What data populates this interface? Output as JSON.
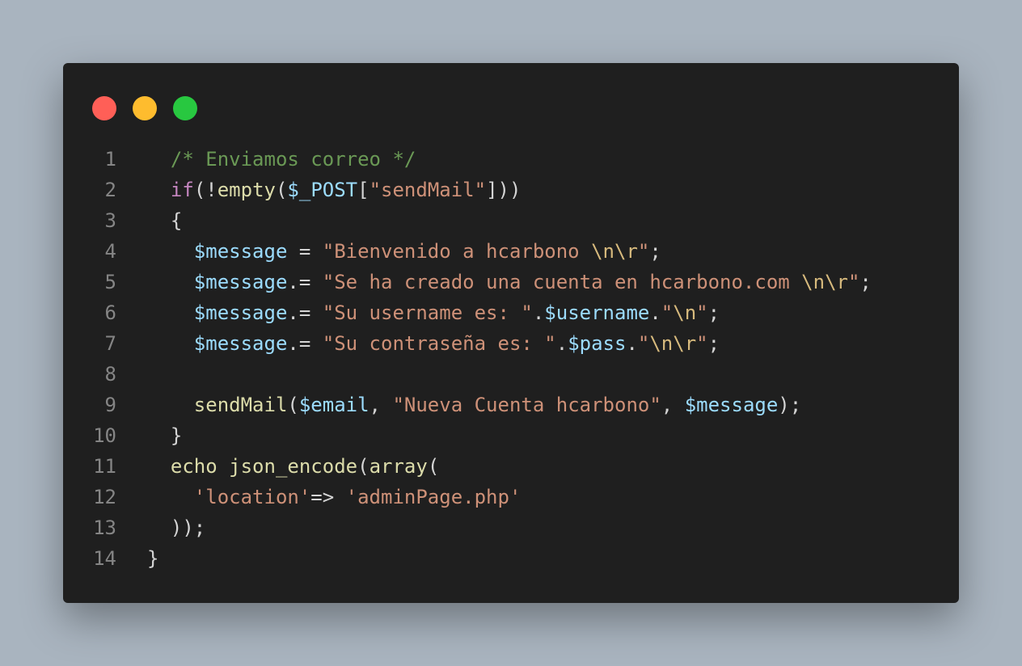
{
  "window": {
    "controls": {
      "close_color": "#ff5f57",
      "minimize_color": "#febc2e",
      "maximize_color": "#28c840"
    }
  },
  "code": {
    "language": "php",
    "line_numbers": [
      "1",
      "2",
      "3",
      "4",
      "5",
      "6",
      "7",
      "8",
      "9",
      "10",
      "11",
      "12",
      "13",
      "14"
    ],
    "lines": [
      [
        {
          "t": "  "
        },
        {
          "t": "/* Enviamos correo */",
          "c": "comment"
        }
      ],
      [
        {
          "t": "  "
        },
        {
          "t": "if",
          "c": "keyword"
        },
        {
          "t": "(!"
        },
        {
          "t": "empty",
          "c": "func"
        },
        {
          "t": "("
        },
        {
          "t": "$_POST",
          "c": "var"
        },
        {
          "t": "["
        },
        {
          "t": "\"sendMail\"",
          "c": "str"
        },
        {
          "t": "]))"
        }
      ],
      [
        {
          "t": "  {"
        }
      ],
      [
        {
          "t": "    "
        },
        {
          "t": "$message",
          "c": "var"
        },
        {
          "t": " = "
        },
        {
          "t": "\"Bienvenido a hcarbono ",
          "c": "str"
        },
        {
          "t": "\\n\\r",
          "c": "esc"
        },
        {
          "t": "\"",
          "c": "str"
        },
        {
          "t": ";"
        }
      ],
      [
        {
          "t": "    "
        },
        {
          "t": "$message",
          "c": "var"
        },
        {
          "t": ".= "
        },
        {
          "t": "\"Se ha creado una cuenta en hcarbono.com ",
          "c": "str"
        },
        {
          "t": "\\n\\r",
          "c": "esc"
        },
        {
          "t": "\"",
          "c": "str"
        },
        {
          "t": ";"
        }
      ],
      [
        {
          "t": "    "
        },
        {
          "t": "$message",
          "c": "var"
        },
        {
          "t": ".= "
        },
        {
          "t": "\"Su username es: \"",
          "c": "str"
        },
        {
          "t": "."
        },
        {
          "t": "$username",
          "c": "var"
        },
        {
          "t": "."
        },
        {
          "t": "\"",
          "c": "str"
        },
        {
          "t": "\\n",
          "c": "esc"
        },
        {
          "t": "\"",
          "c": "str"
        },
        {
          "t": ";"
        }
      ],
      [
        {
          "t": "    "
        },
        {
          "t": "$message",
          "c": "var"
        },
        {
          "t": ".= "
        },
        {
          "t": "\"Su contraseña es: \"",
          "c": "str"
        },
        {
          "t": "."
        },
        {
          "t": "$pass",
          "c": "var"
        },
        {
          "t": "."
        },
        {
          "t": "\"",
          "c": "str"
        },
        {
          "t": "\\n\\r",
          "c": "esc"
        },
        {
          "t": "\"",
          "c": "str"
        },
        {
          "t": ";"
        }
      ],
      [],
      [
        {
          "t": "    "
        },
        {
          "t": "sendMail",
          "c": "func"
        },
        {
          "t": "("
        },
        {
          "t": "$email",
          "c": "var"
        },
        {
          "t": ", "
        },
        {
          "t": "\"Nueva Cuenta hcarbono\"",
          "c": "str"
        },
        {
          "t": ", "
        },
        {
          "t": "$message",
          "c": "var"
        },
        {
          "t": ");"
        }
      ],
      [
        {
          "t": "  }"
        }
      ],
      [
        {
          "t": "  "
        },
        {
          "t": "echo",
          "c": "func"
        },
        {
          "t": " "
        },
        {
          "t": "json_encode",
          "c": "func"
        },
        {
          "t": "("
        },
        {
          "t": "array",
          "c": "func"
        },
        {
          "t": "("
        }
      ],
      [
        {
          "t": "    "
        },
        {
          "t": "'location'",
          "c": "str"
        },
        {
          "t": "=> "
        },
        {
          "t": "'adminPage.php'",
          "c": "str"
        }
      ],
      [
        {
          "t": "  ));"
        }
      ],
      [
        {
          "t": "}"
        }
      ]
    ]
  }
}
